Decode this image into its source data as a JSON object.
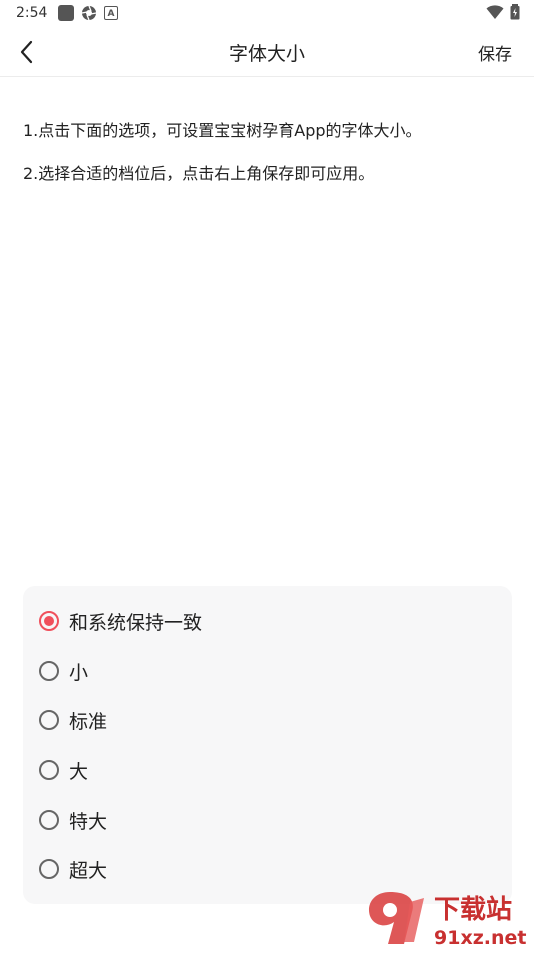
{
  "status": {
    "time": "2:54",
    "badge_letter": "A"
  },
  "header": {
    "title": "字体大小",
    "save_label": "保存"
  },
  "tips": [
    "1.点击下面的选项，可设置宝宝树孕育App的字体大小。",
    "2.选择合适的档位后，点击右上角保存即可应用。"
  ],
  "options": [
    {
      "label": "和系统保持一致",
      "selected": true
    },
    {
      "label": "小",
      "selected": false
    },
    {
      "label": "标准",
      "selected": false
    },
    {
      "label": "大",
      "selected": false
    },
    {
      "label": "特大",
      "selected": false
    },
    {
      "label": "超大",
      "selected": false
    }
  ],
  "watermark": {
    "top": "下载站",
    "bottom": "91xz.net"
  },
  "colors": {
    "accent": "#f0505c",
    "card_bg": "#f7f7f8"
  }
}
